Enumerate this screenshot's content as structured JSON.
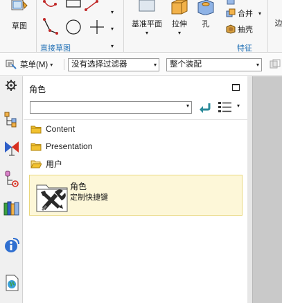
{
  "ribbon": {
    "sketch_label": "草图",
    "direct_sketch_group": "直接草图",
    "datum_plane_label": "基准平面",
    "extrude_label": "拉伸",
    "hole_label": "孔",
    "unite_label": "合并",
    "shell_label": "抽壳",
    "feature_group": "特征",
    "cut_label": "边",
    "dropdown_glyph": "▾"
  },
  "toolbar": {
    "menu_label": "菜单(M)",
    "menu_arrow": "▾",
    "filter_value": "没有选择过滤器",
    "assembly_value": "整个装配",
    "dropdown_glyph": "▾"
  },
  "panel": {
    "title": "角色",
    "filter_value": "",
    "dropdown_glyph": "▾",
    "tree": [
      {
        "label": "Content"
      },
      {
        "label": "Presentation"
      },
      {
        "label": "用户"
      }
    ],
    "role_item": {
      "name": "角色",
      "description": "定制快捷键"
    }
  },
  "colors": {
    "accent": "#1f6fb5",
    "highlight_bg": "#fdf7d8",
    "folder": "#f2c230"
  },
  "icons": [
    "sketch-icon",
    "direct-sketch-tools",
    "datum-plane-icon",
    "extrude-icon",
    "hole-icon",
    "unite-icon",
    "shell-icon",
    "menu-icon",
    "gear-icon",
    "part-navigator-icon",
    "assembly-navigator-icon",
    "constraint-navigator-icon",
    "reuse-library-icon",
    "history-icon",
    "web-browser-icon",
    "folder-icon",
    "back-arrow-icon",
    "list-view-icon",
    "role-tools-icon"
  ]
}
